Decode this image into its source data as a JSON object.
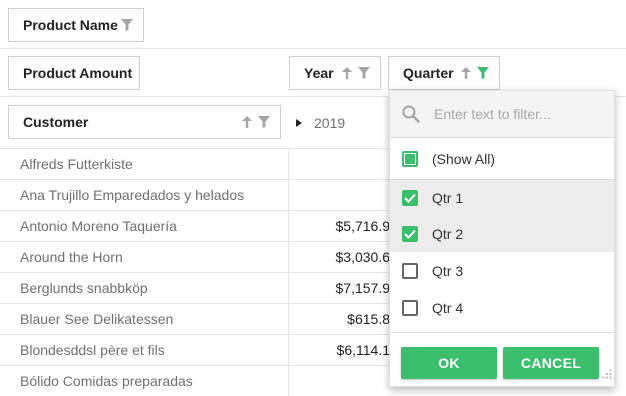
{
  "header": {
    "product_name": "Product Name",
    "product_amount": "Product Amount",
    "year": "Year",
    "quarter": "Quarter",
    "customer": "Customer"
  },
  "column_header": {
    "year_value": "2019"
  },
  "rows": [
    {
      "customer": "Alfreds Futterkiste",
      "amount": ""
    },
    {
      "customer": "Ana Trujillo Emparedados y helados",
      "amount": ""
    },
    {
      "customer": "Antonio Moreno Taquería",
      "amount": "$5,716.9"
    },
    {
      "customer": "Around the Horn",
      "amount": "$3,030.6"
    },
    {
      "customer": "Berglunds snabbköp",
      "amount": "$7,157.9"
    },
    {
      "customer": "Blauer See Delikatessen",
      "amount": "$615.8"
    },
    {
      "customer": "Blondesddsl père et fils",
      "amount": "$6,114.1"
    },
    {
      "customer": "Bólido Comidas preparadas",
      "amount": ""
    }
  ],
  "filter_popup": {
    "search_placeholder": "Enter text to filter...",
    "show_all": "(Show All)",
    "options": [
      {
        "label": "Qtr 1",
        "checked": true
      },
      {
        "label": "Qtr 2",
        "checked": true
      },
      {
        "label": "Qtr 3",
        "checked": false
      },
      {
        "label": "Qtr 4",
        "checked": false
      }
    ],
    "ok_label": "OK",
    "cancel_label": "CANCEL"
  },
  "colors": {
    "accent": "#3cbf6c",
    "icon_gray": "#a6a6a6"
  }
}
